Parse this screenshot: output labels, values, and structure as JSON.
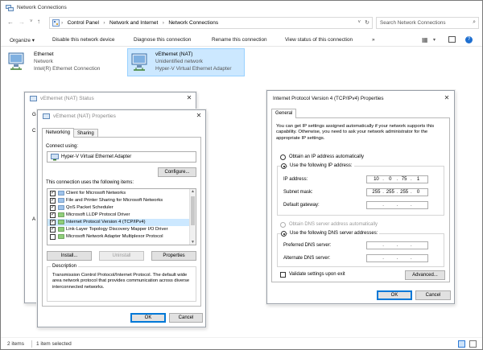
{
  "explorer": {
    "title": "Network Connections",
    "breadcrumb": [
      "Control Panel",
      "Network and Internet",
      "Network Connections"
    ],
    "search_placeholder": "Search Network Connections",
    "commands": [
      "Organize ▾",
      "Disable this network device",
      "Diagnose this connection",
      "Rename this connection",
      "View status of this connection",
      "»"
    ],
    "adapters": [
      {
        "name": "Ethernet",
        "line2": "Network",
        "line3": "Intel(R) Ethernet Connection"
      },
      {
        "name": "vEthernet (NAT)",
        "line2": "Unidentified network",
        "line3": "Hyper-V Virtual Ethernet Adapter"
      }
    ],
    "status_count": "2 items",
    "status_selected": "1 item selected"
  },
  "status_window": {
    "title": "vEthernet (NAT) Status",
    "partial_tab": "Ge",
    "partial_c": "C",
    "partial_a": "A"
  },
  "props_window": {
    "title": "vEthernet (NAT) Properties",
    "tabs": [
      "Networking",
      "Sharing"
    ],
    "connect_using_label": "Connect using:",
    "adapter_name": "Hyper-V Virtual Ethernet Adapter",
    "configure_label": "Configure...",
    "items_label": "This connection uses the following items:",
    "items": [
      {
        "label": "Client for Microsoft Networks",
        "checked": "✓"
      },
      {
        "label": "File and Printer Sharing for Microsoft Networks",
        "checked": "✓"
      },
      {
        "label": "QoS Packet Scheduler",
        "checked": "✓"
      },
      {
        "label": "Microsoft LLDP Protocol Driver",
        "checked": "✓"
      },
      {
        "label": "Internet Protocol Version 4 (TCP/IPv4)",
        "checked": "✓"
      },
      {
        "label": "Link-Layer Topology Discovery Mapper I/O Driver",
        "checked": "✓"
      },
      {
        "label": "Microsoft Network Adapter Multiplexor Protocol",
        "checked": ""
      }
    ],
    "install_label": "Install...",
    "uninstall_label": "Uninstall",
    "properties_label": "Properties",
    "description_title": "Description",
    "description_text": "Transmission Control Protocol/Internet Protocol. The default wide area network protocol that provides communication across diverse interconnected networks.",
    "ok_label": "OK",
    "cancel_label": "Cancel"
  },
  "ipv4_window": {
    "title": "Internet Protocol Version 4 (TCP/IPv4) Properties",
    "tab": "General",
    "intro": "You can get IP settings assigned automatically if your network supports this capability. Otherwise, you need to ask your network administrator for the appropriate IP settings.",
    "obtain_ip_auto": "Obtain an IP address automatically",
    "use_following_ip": "Use the following IP address:",
    "ip_label": "IP address:",
    "subnet_label": "Subnet mask:",
    "gateway_label": "Default gateway:",
    "ip_octets": [
      "10",
      "0",
      "75",
      "1"
    ],
    "subnet_octets": [
      "255",
      "255",
      "255",
      "0"
    ],
    "obtain_dns_auto": "Obtain DNS server address automatically",
    "use_following_dns": "Use the following DNS server addresses:",
    "preferred_dns_label": "Preferred DNS server:",
    "alternate_dns_label": "Alternate DNS server:",
    "validate_label": "Validate settings upon exit",
    "advanced_label": "Advanced...",
    "ok_label": "OK",
    "cancel_label": "Cancel"
  }
}
